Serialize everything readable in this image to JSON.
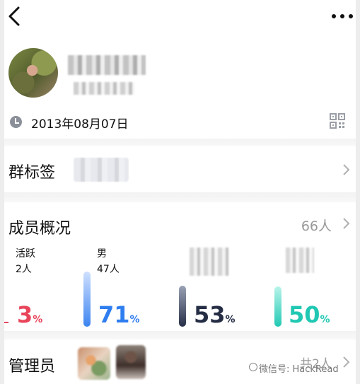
{
  "header": {
    "back_icon": "back-arrow-icon",
    "more_icon": "more-icon"
  },
  "profile": {
    "date": "2013年08月07日",
    "clock_icon": "clock-icon",
    "qr_icon": "qr-code-icon"
  },
  "group_tag": {
    "label": "群标签"
  },
  "members": {
    "title": "成员概况",
    "count": "66人",
    "stats": [
      {
        "label": "活跃",
        "sub": "2人",
        "value": "3",
        "unit": "%",
        "color": "#e8455b"
      },
      {
        "label": "男",
        "sub": "47人",
        "value": "71",
        "unit": "%",
        "color": "#2f7ef0"
      },
      {
        "value": "53",
        "unit": "%",
        "color": "#252d45"
      },
      {
        "value": "50",
        "unit": "%",
        "color": "#20c8b3"
      }
    ]
  },
  "admins": {
    "title": "管理员",
    "count": "共2人"
  },
  "watermark": {
    "text": "微信号: HackRead"
  }
}
